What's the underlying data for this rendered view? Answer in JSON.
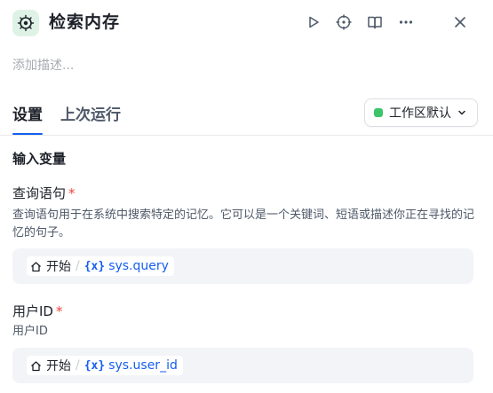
{
  "header": {
    "title": "检索内存",
    "description_placeholder": "添加描述..."
  },
  "tabs": [
    {
      "label": "设置",
      "active": true
    },
    {
      "label": "上次运行",
      "active": false
    }
  ],
  "workspace_select": {
    "label": "工作区默认",
    "status_color": "#3cc46a"
  },
  "section": {
    "title": "输入变量"
  },
  "fields": [
    {
      "label": "查询语句",
      "required_mark": "*",
      "help": "查询语句用于在系统中搜索特定的记忆。它可以是一个关键词、短语或描述你正在寻找的记忆的句子。",
      "source": "开始",
      "variable": "sys.query"
    },
    {
      "label": "用户ID",
      "required_mark": "*",
      "help": "用户ID",
      "source": "开始",
      "variable": "sys.user_id"
    }
  ],
  "icons": {
    "app": "memory-node-icon",
    "toolbar": [
      "play-icon",
      "crosshair-icon",
      "book-icon",
      "more-icon",
      "close-icon"
    ]
  },
  "colors": {
    "accent": "#155eef",
    "required": "#f04438"
  }
}
